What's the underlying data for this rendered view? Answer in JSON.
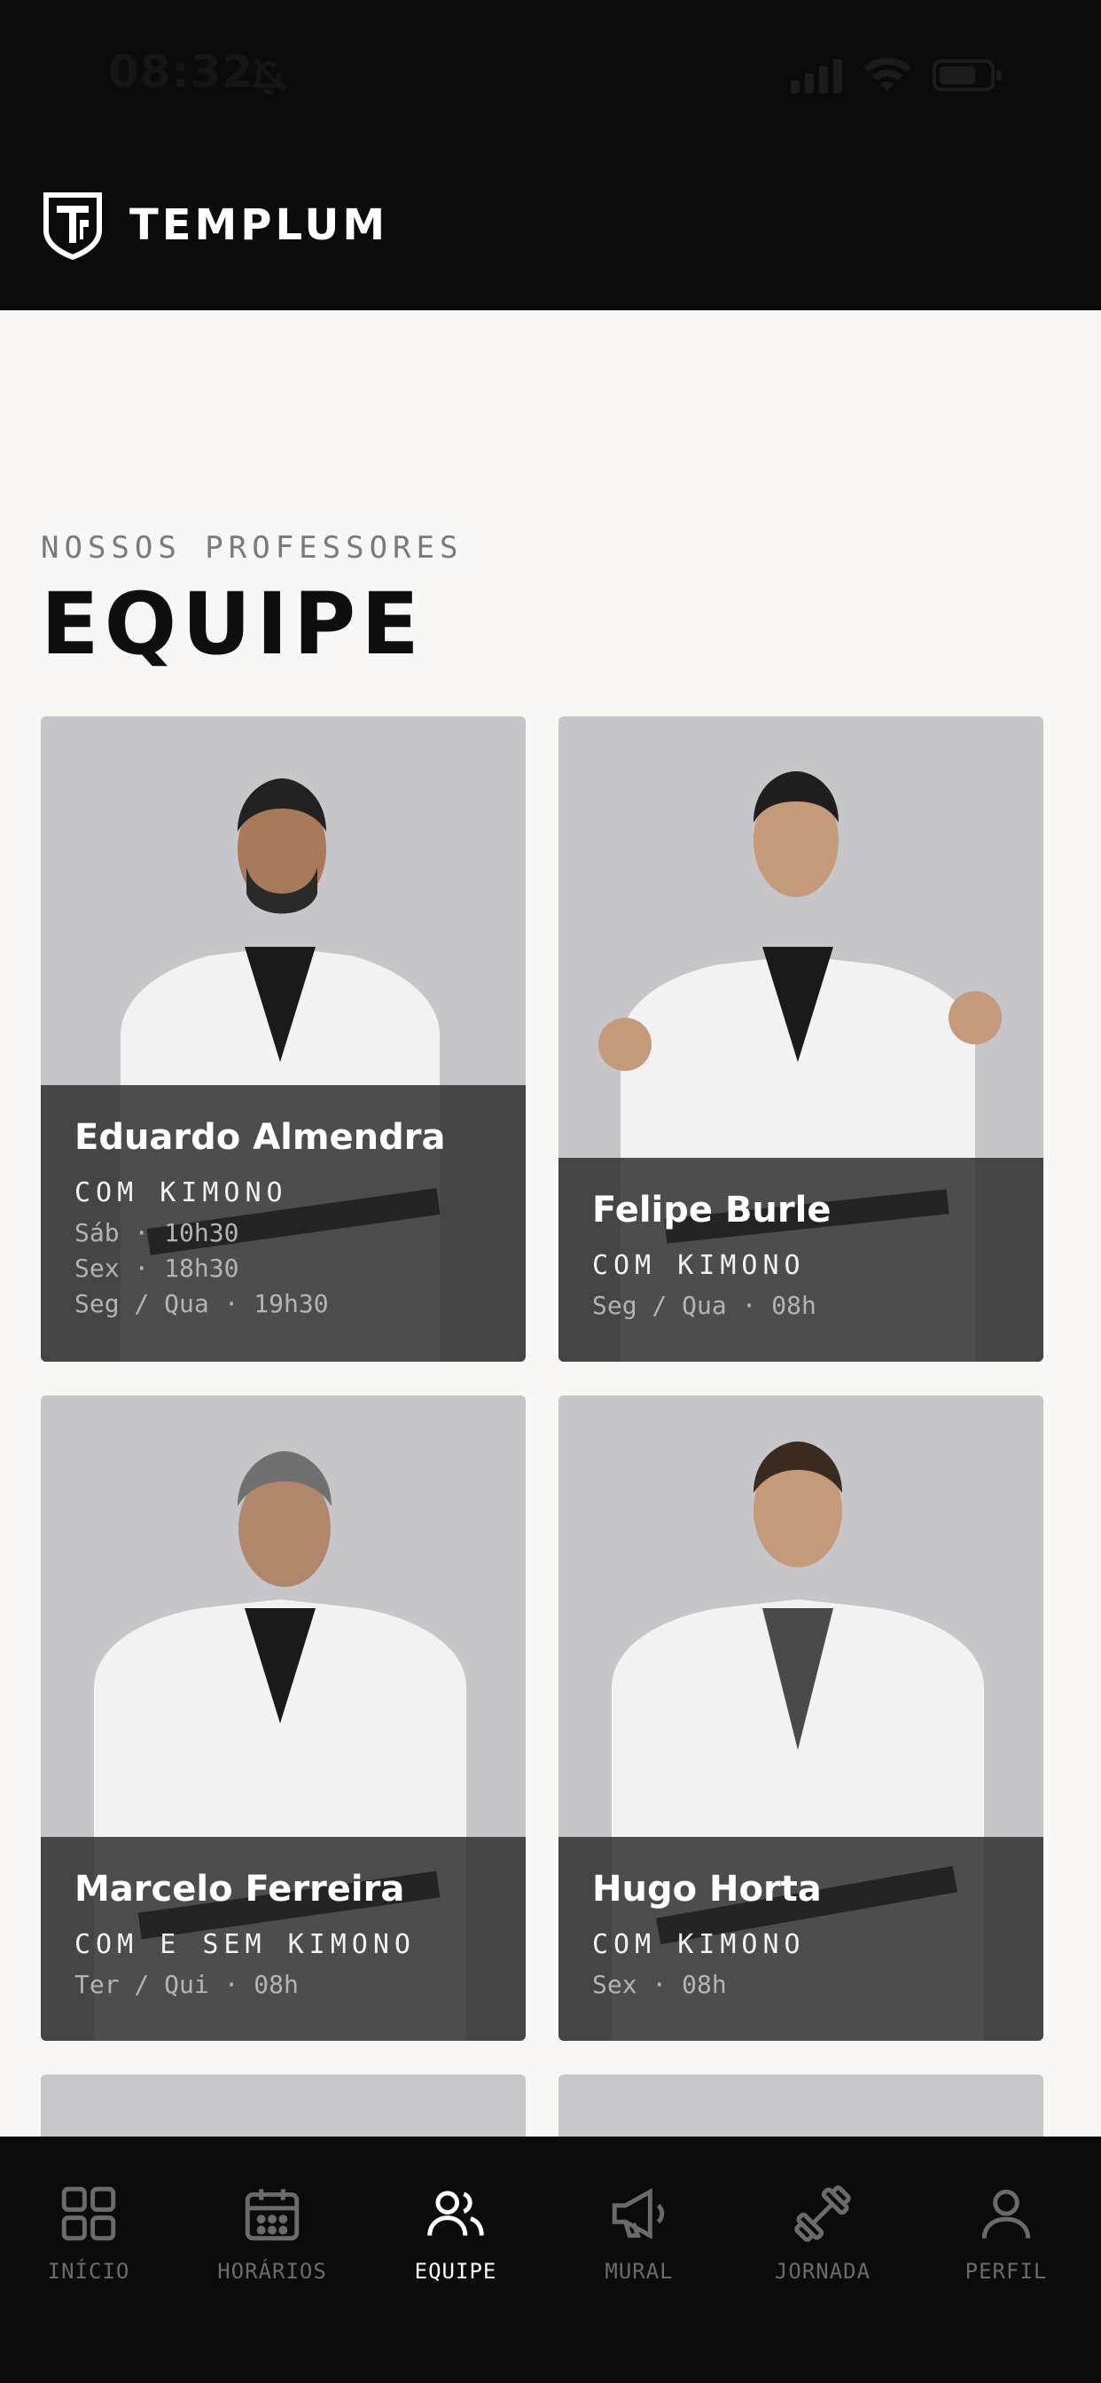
{
  "status_bar": {
    "time": "08:32"
  },
  "header": {
    "brand": "TEMPLUM"
  },
  "section": {
    "eyebrow": "NOSSOS PROFESSORES",
    "title": "EQUIPE"
  },
  "teachers": [
    {
      "name": "Eduardo Almendra",
      "category": "COM KIMONO",
      "schedule": [
        "Sáb · 10h30",
        "Sex · 18h30",
        "Seg / Qua · 19h30"
      ]
    },
    {
      "name": "Felipe Burle",
      "category": "COM KIMONO",
      "schedule": [
        "Seg / Qua · 08h"
      ]
    },
    {
      "name": "Marcelo Ferreira",
      "category": "COM E SEM KIMONO",
      "schedule": [
        "Ter / Qui · 08h"
      ]
    },
    {
      "name": "Hugo Horta",
      "category": "COM KIMONO",
      "schedule": [
        "Sex · 08h"
      ]
    }
  ],
  "bottom_nav": [
    {
      "label": "INÍCIO",
      "icon": "grid-icon",
      "active": false
    },
    {
      "label": "HORÁRIOS",
      "icon": "calendar-icon",
      "active": false
    },
    {
      "label": "EQUIPE",
      "icon": "users-icon",
      "active": true
    },
    {
      "label": "MURAL",
      "icon": "megaphone-icon",
      "active": false
    },
    {
      "label": "JORNADA",
      "icon": "dumbbell-icon",
      "active": false
    },
    {
      "label": "PERFIL",
      "icon": "user-icon",
      "active": false
    }
  ],
  "colors": {
    "background": "#f8f7f5",
    "header": "#0b0b0b",
    "overlay": "#282828",
    "active_nav": "#ffffff",
    "inactive_nav": "#6b6b6b"
  }
}
